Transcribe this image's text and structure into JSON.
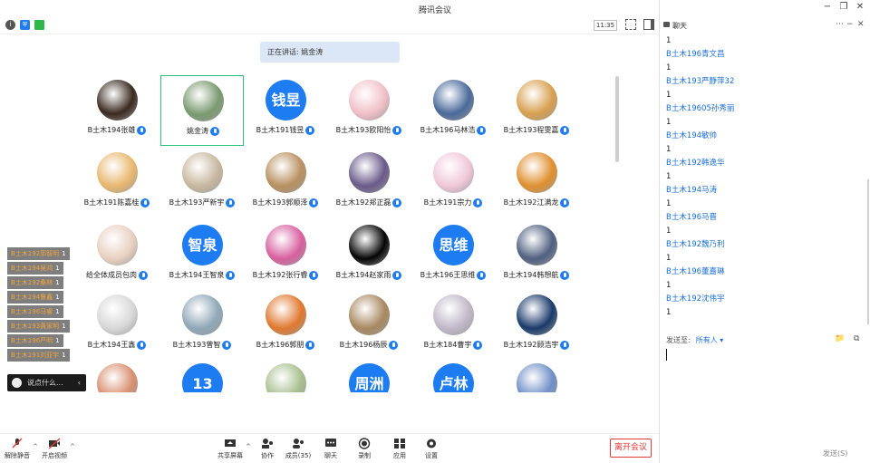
{
  "window": {
    "title": "腾讯会议",
    "controls": [
      "minimize-icon",
      "restore-icon",
      "close-icon"
    ]
  },
  "toolbar": {
    "clock": "11:35",
    "left_icons": [
      "info-icon",
      "shield-icon",
      "signal-icon"
    ],
    "right_icons": [
      "fullscreen-icon",
      "layout-icon"
    ]
  },
  "speaking": {
    "text": "正在讲话: 姚金涛"
  },
  "participants": [
    {
      "name": "B土木194张雄",
      "avatar": "photo",
      "color": "#3a2a20"
    },
    {
      "name": "姚金涛",
      "avatar": "photo",
      "color": "#7a9a70",
      "selected": true
    },
    {
      "name": "B土木191钱昱",
      "avatar": "text",
      "avatar_text": "钱昱"
    },
    {
      "name": "B土木193欧阳怡",
      "avatar": "photo",
      "color": "#f0c0c8"
    },
    {
      "name": "B土木196马林浩",
      "avatar": "photo",
      "color": "#4a6a9a"
    },
    {
      "name": "B土木193程雯嘉",
      "avatar": "photo",
      "color": "#d8a050"
    },
    {
      "name": "B土木191陈嘉桂",
      "avatar": "photo",
      "color": "#e8b870"
    },
    {
      "name": "B土木193严新宇",
      "avatar": "photo",
      "color": "#c8b8a0"
    },
    {
      "name": "B土木193郭顺泽",
      "avatar": "photo",
      "color": "#b89060"
    },
    {
      "name": "B土木192郑正磊",
      "avatar": "photo",
      "color": "#6a5a8a"
    },
    {
      "name": "B土木191宗力",
      "avatar": "photo",
      "color": "#f0c8d8"
    },
    {
      "name": "B土木192江满龙",
      "avatar": "photo",
      "color": "#e09030"
    },
    {
      "name": "给全体成员包肉",
      "avatar": "photo",
      "color": "#e8d0c0"
    },
    {
      "name": "B土木194王智泉",
      "avatar": "text",
      "avatar_text": "智泉"
    },
    {
      "name": "B土木192张行睿",
      "avatar": "photo",
      "color": "#d860a0"
    },
    {
      "name": "B土木194赵家雨",
      "avatar": "photo",
      "color": "#050505"
    },
    {
      "name": "B土木196王思维",
      "avatar": "text",
      "avatar_text": "思维"
    },
    {
      "name": "B土木194韩想航",
      "avatar": "photo",
      "color": "#506080"
    },
    {
      "name": "B土木194王鑫",
      "avatar": "photo",
      "color": "#d8d8d8"
    },
    {
      "name": "B土木193曾智",
      "avatar": "photo",
      "color": "#90a8b8"
    },
    {
      "name": "B土木196郭朋",
      "avatar": "photo",
      "color": "#e07830"
    },
    {
      "name": "B土木196杨辰",
      "avatar": "photo",
      "color": "#a88860"
    },
    {
      "name": "B土木184曹宇",
      "avatar": "photo",
      "color": "#c0b8c8"
    },
    {
      "name": "B土木192顾浩宇",
      "avatar": "photo",
      "color": "#1a3a6a"
    },
    {
      "name": "",
      "avatar": "photo",
      "color": "#d89070"
    },
    {
      "name": "",
      "avatar": "text",
      "avatar_text": "13"
    },
    {
      "name": "",
      "avatar": "photo",
      "color": "#a8c090"
    },
    {
      "name": "",
      "avatar": "text",
      "avatar_text": "周洲"
    },
    {
      "name": "",
      "avatar": "text",
      "avatar_text": "卢林"
    },
    {
      "name": "",
      "avatar": "photo",
      "color": "#7090c8"
    }
  ],
  "reactions": [
    {
      "name": "B土木192郭智明",
      "count": "1"
    },
    {
      "name": "B土木194吴鸿",
      "count": "1"
    },
    {
      "name": "B土木192桑林",
      "count": "1"
    },
    {
      "name": "B土木194鲁鑫",
      "count": "1"
    },
    {
      "name": "B土木196马睿",
      "count": "1"
    },
    {
      "name": "B土木193黄家明",
      "count": "1"
    },
    {
      "name": "B土木196严明",
      "count": "1"
    },
    {
      "name": "B土木191刘亚宇",
      "count": "1"
    }
  ],
  "chat_input": {
    "placeholder": "说点什么..."
  },
  "bottombar": {
    "buttons": [
      {
        "label": "解除静音",
        "icon": "mic-off-icon"
      },
      {
        "label": "开启视频",
        "icon": "camera-off-icon"
      },
      {
        "label": "共享屏幕",
        "icon": "share-screen-icon"
      },
      {
        "label": "协作",
        "icon": "collaborate-icon"
      },
      {
        "label": "成员(35)",
        "icon": "members-icon"
      },
      {
        "label": "聊天",
        "icon": "chat-icon"
      },
      {
        "label": "录制",
        "icon": "record-icon"
      },
      {
        "label": "应用",
        "icon": "apps-icon"
      },
      {
        "label": "设置",
        "icon": "settings-icon"
      }
    ],
    "leave": "离开会议"
  },
  "chat": {
    "title": "聊天",
    "messages": [
      {
        "sender": "",
        "text": "1"
      },
      {
        "sender": "B土木196青文昌",
        "text": "1"
      },
      {
        "sender": "B土木193严静萍32",
        "text": "1"
      },
      {
        "sender": "B土木19605孙秀丽",
        "text": "1"
      },
      {
        "sender": "B土木194敏帅",
        "text": "1"
      },
      {
        "sender": "B土木192韩逸华",
        "text": "1"
      },
      {
        "sender": "B土木194马涛",
        "text": "1"
      },
      {
        "sender": "B土木196马晋",
        "text": "1"
      },
      {
        "sender": "B土木192魏乃利",
        "text": "1"
      },
      {
        "sender": "B土木196董嘉琳",
        "text": "1"
      },
      {
        "sender": "B土木192沈伟宇",
        "text": "1"
      }
    ],
    "send_to_label": "发送至:",
    "recipient": "所有人 ▾",
    "send_button": "发送(S)"
  }
}
